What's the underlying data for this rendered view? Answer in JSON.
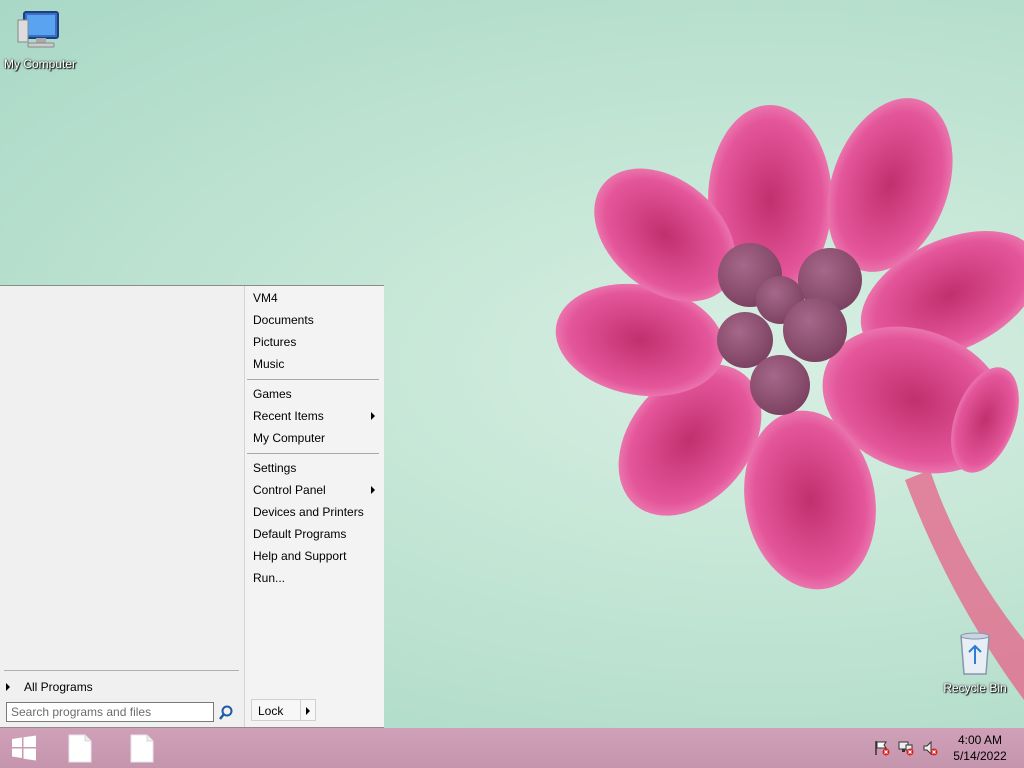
{
  "desktop": {
    "icons": [
      {
        "label": "My Computer",
        "icon": "computer-monitor-icon"
      },
      {
        "label": "Recycle Bin",
        "icon": "recycle-bin-icon"
      }
    ]
  },
  "start_menu": {
    "all_programs_label": "All Programs",
    "search": {
      "placeholder": "Search programs and files",
      "value": ""
    },
    "right_items": [
      {
        "label": "VM4"
      },
      {
        "label": "Documents"
      },
      {
        "label": "Pictures"
      },
      {
        "label": "Music"
      },
      {
        "label": "Games"
      },
      {
        "label": "Recent Items",
        "submenu": true
      },
      {
        "label": "My Computer"
      },
      {
        "label": "Settings"
      },
      {
        "label": "Control Panel",
        "submenu": true
      },
      {
        "label": "Devices and Printers"
      },
      {
        "label": "Default Programs"
      },
      {
        "label": "Help and Support"
      },
      {
        "label": "Run..."
      }
    ],
    "lock_label": "Lock"
  },
  "taskbar": {
    "buttons": [
      "windows-logo-icon",
      "file-icon",
      "file-icon"
    ],
    "tray_icons": [
      "flag-icon",
      "network-icon",
      "speaker-muted-icon"
    ],
    "clock": {
      "time": "4:00 AM",
      "date": "5/14/2022"
    }
  },
  "colors": {
    "taskbar": "#c998b2",
    "menu_bg": "#f0f0f0",
    "flower": "#e0569a"
  }
}
